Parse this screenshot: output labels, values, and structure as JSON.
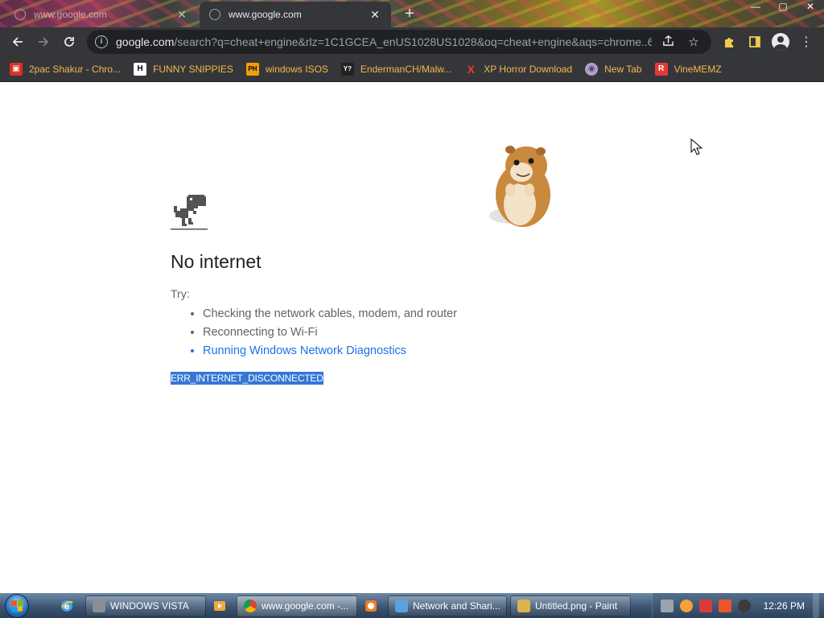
{
  "browser": {
    "tabs": [
      {
        "title": "www.google.com",
        "active": false
      },
      {
        "title": "www.google.com",
        "active": true
      }
    ],
    "new_tab": "+",
    "window_controls": {
      "minimize": "—",
      "maximize": "▢",
      "close": "✕"
    },
    "address": {
      "host": "google.com",
      "path": "/search?q=cheat+engine&rlz=1C1GCEA_enUS1028US1028&oq=cheat+engine&aqs=chrome..6..."
    },
    "bookmarks": [
      {
        "label": "2pac Shakur - Chro...",
        "icon": "media-icon",
        "color": "#d93025",
        "glyph": "▣"
      },
      {
        "label": "FUNNY SNIPPIES",
        "icon": "h-icon",
        "color": "#ffffff",
        "glyph": "H"
      },
      {
        "label": "windows ISOS",
        "icon": "ph-icon",
        "color": "#f29d0a",
        "glyph": "PH"
      },
      {
        "label": "EndermanCH/Malw...",
        "icon": "yp-icon",
        "color": "#ffffff",
        "glyph": "Y?"
      },
      {
        "label": "XP Horror Download",
        "icon": "x-icon",
        "color": "#e53935",
        "glyph": "X"
      },
      {
        "label": "New Tab",
        "icon": "globe-icon",
        "color": "#9aa0a6",
        "glyph": "◉"
      },
      {
        "label": "VineMEMZ",
        "icon": "r-icon",
        "color": "#e53935",
        "glyph": "R"
      }
    ]
  },
  "page": {
    "heading": "No internet",
    "try_label": "Try:",
    "suggestions": [
      "Checking the network cables, modem, and router",
      "Reconnecting to Wi-Fi",
      "Running Windows Network Diagnostics"
    ],
    "error_code": "ERR_INTERNET_DISCONNECTED"
  },
  "taskbar": {
    "tasks": [
      {
        "label": "WINDOWS VISTA",
        "color": "#8a8f96"
      },
      {
        "label": "www.google.com -...",
        "color": "#e8a93a",
        "active": true
      },
      {
        "label": "Network and Shari...",
        "color": "#5aa3e0"
      },
      {
        "label": "Untitled.png - Paint",
        "color": "#d9b44a"
      }
    ],
    "clock": "12:26 PM"
  }
}
